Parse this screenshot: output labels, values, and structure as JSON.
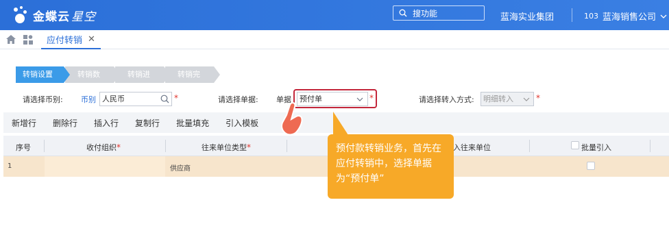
{
  "header": {
    "logo_text": "金蝶云",
    "logo_sub": "星空",
    "search_placeholder": "搜功能",
    "org_name": "蓝海实业集团",
    "user_code": "103",
    "user_org": "蓝海销售公司"
  },
  "tabs": {
    "active_label": "应付转销",
    "close_glyph": "✕"
  },
  "steps": [
    {
      "label": "转销设置",
      "color": "#3b9be8"
    },
    {
      "label": "转销数据",
      "color": "#d3d6db"
    },
    {
      "label": "转销进度",
      "color": "#d3d6db"
    },
    {
      "label": "转销完成",
      "color": "#d3d6db"
    }
  ],
  "form": {
    "currency_prompt": "请选择币别:",
    "currency_label": "币别",
    "currency_value": "人民币",
    "doc_prompt": "请选择单据:",
    "doc_label": "单据",
    "doc_value": "预付单",
    "mode_prompt": "请选择转入方式:",
    "mode_value": "明细转入",
    "required_mark": "*"
  },
  "toolbar": {
    "buttons": [
      "新增行",
      "删除行",
      "插入行",
      "复制行",
      "批量填充",
      "引入模板"
    ]
  },
  "grid": {
    "headers": {
      "seq": "序号",
      "org": "收付组织",
      "partner_type": "往来单位类型",
      "partner_in": "转入往来单位",
      "batch": "批量引入"
    },
    "rows": [
      {
        "seq": "1",
        "partner_type": "供应商"
      }
    ]
  },
  "tooltip": {
    "text": "预付款转销业务，首先在应付转销中，选择单据为“预付单”"
  },
  "colors": {
    "header_blue": "#2b6fd8",
    "tooltip_orange": "#f7a928",
    "highlight_red": "#c3263a",
    "row_highlight": "#f7e5cc"
  }
}
